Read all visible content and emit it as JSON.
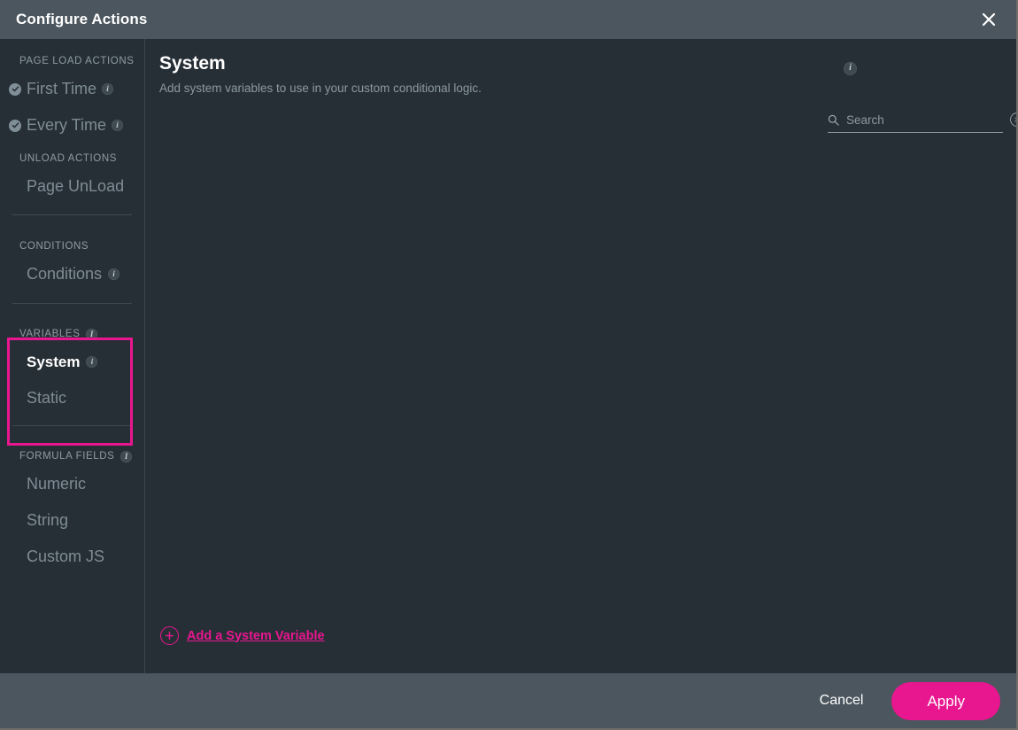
{
  "window": {
    "title": "Configure Actions",
    "close_icon": "close-icon"
  },
  "sidebar": {
    "sections": [
      {
        "heading": "PAGE LOAD ACTIONS",
        "has_info": false,
        "items": [
          {
            "label": "First Time",
            "checked": true,
            "has_info": true,
            "active": false
          },
          {
            "label": "Every Time",
            "checked": true,
            "has_info": true,
            "active": false
          }
        ]
      },
      {
        "heading": "UNLOAD ACTIONS",
        "has_info": false,
        "items": [
          {
            "label": "Page UnLoad",
            "checked": false,
            "has_info": false,
            "active": false
          }
        ]
      },
      {
        "heading": "CONDITIONS",
        "has_info": false,
        "items": [
          {
            "label": "Conditions",
            "checked": false,
            "has_info": true,
            "active": false
          }
        ]
      },
      {
        "heading": "VARIABLES",
        "has_info": true,
        "highlighted": true,
        "items": [
          {
            "label": "System",
            "checked": false,
            "has_info": true,
            "active": true
          },
          {
            "label": "Static",
            "checked": false,
            "has_info": false,
            "active": false
          }
        ]
      },
      {
        "heading": "FORMULA FIELDS",
        "has_info": true,
        "items": [
          {
            "label": "Numeric",
            "checked": false,
            "has_info": false,
            "active": false
          },
          {
            "label": "String",
            "checked": false,
            "has_info": false,
            "active": false
          },
          {
            "label": "Custom JS",
            "checked": false,
            "has_info": false,
            "active": false
          }
        ]
      }
    ]
  },
  "main": {
    "title": "System",
    "subtitle": "Add system variables to use in your custom conditional logic.",
    "info_icon": "info-icon",
    "search": {
      "placeholder": "Search",
      "value": "",
      "search_icon": "search-icon",
      "clear_icon": "clear-icon"
    },
    "add_action": {
      "label": "Add a System Variable",
      "icon": "plus-circle-icon"
    },
    "empty_list": []
  },
  "footer": {
    "cancel_label": "Cancel",
    "apply_label": "Apply"
  },
  "colors": {
    "accent": "#e8168f",
    "chrome": "#4b565e",
    "panel": "#272f36",
    "muted_text": "#8b99a1"
  }
}
